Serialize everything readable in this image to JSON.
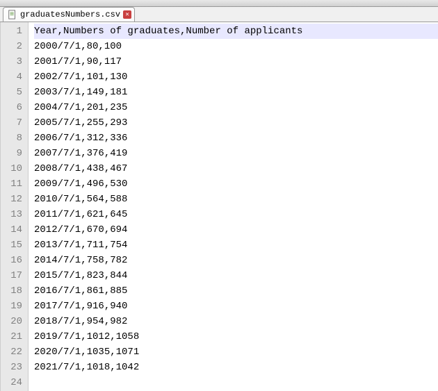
{
  "tab": {
    "filename": "graduatesNumbers.csv"
  },
  "editor": {
    "active_line": 1,
    "lines": [
      "Year,Numbers of graduates,Number of applicants",
      "2000/7/1,80,100",
      "2001/7/1,90,117",
      "2002/7/1,101,130",
      "2003/7/1,149,181",
      "2004/7/1,201,235",
      "2005/7/1,255,293",
      "2006/7/1,312,336",
      "2007/7/1,376,419",
      "2008/7/1,438,467",
      "2009/7/1,496,530",
      "2010/7/1,564,588",
      "2011/7/1,621,645",
      "2012/7/1,670,694",
      "2013/7/1,711,754",
      "2014/7/1,758,782",
      "2015/7/1,823,844",
      "2016/7/1,861,885",
      "2017/7/1,916,940",
      "2018/7/1,954,982",
      "2019/7/1,1012,1058",
      "2020/7/1,1035,1071",
      "2021/7/1,1018,1042",
      ""
    ]
  }
}
